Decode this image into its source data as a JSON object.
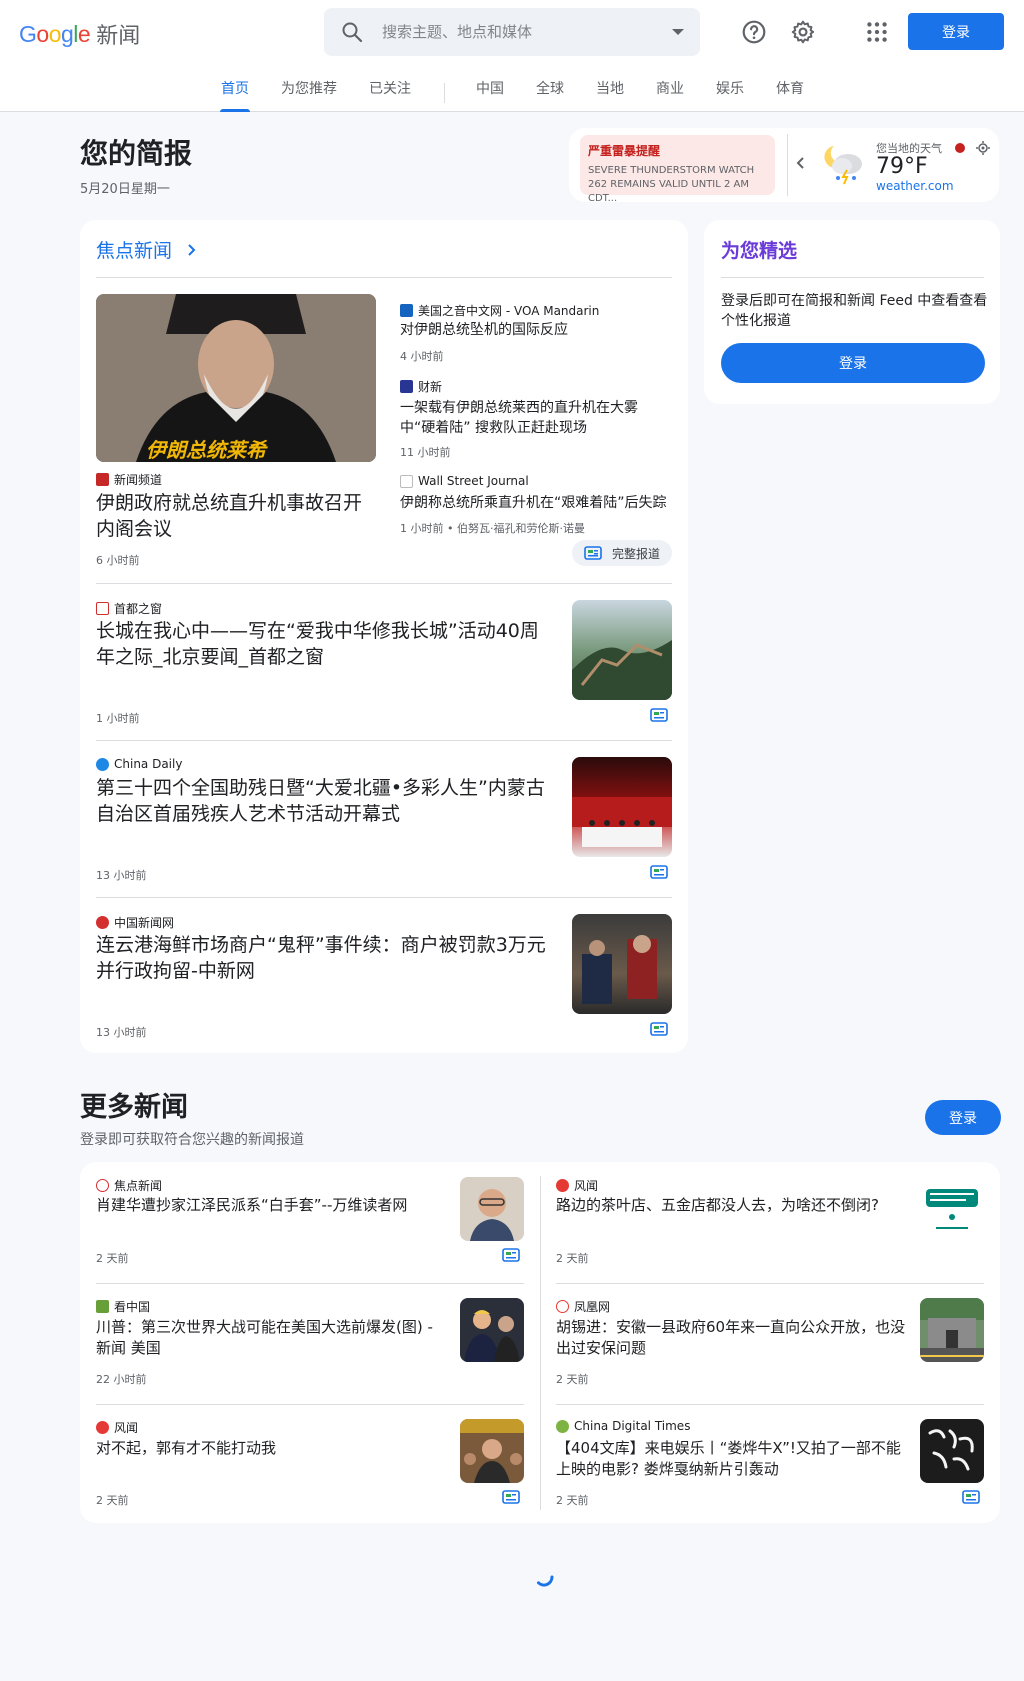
{
  "header": {
    "logo_text": "Google",
    "logo_suffix": "新闻",
    "search_placeholder": "搜索主题、地点和媒体",
    "login_label": "登录",
    "icons": [
      "search-icon",
      "help-icon",
      "settings-icon",
      "apps-icon"
    ]
  },
  "tabs": [
    {
      "label": "首页",
      "active": true
    },
    {
      "label": "为您推荐"
    },
    {
      "label": "已关注"
    },
    {
      "label": "中国"
    },
    {
      "label": "全球"
    },
    {
      "label": "当地"
    },
    {
      "label": "商业"
    },
    {
      "label": "娱乐"
    },
    {
      "label": "体育"
    }
  ],
  "briefing": {
    "title": "您的简报",
    "date": "5月20日星期一"
  },
  "weather": {
    "alert_title": "严重雷暴提醒",
    "alert_body": "SEVERE THUNDERSTORM WATCH 262 REMAINS VALID UNTIL 2 AM CDT...",
    "label": "您当地的天气",
    "temperature": "79°F",
    "source": "weather.com",
    "icon": "night-thunderstorm-icon"
  },
  "top_stories": {
    "title": "焦点新闻",
    "lead": {
      "source": "新闻频道",
      "headline": "伊朗政府就总统直升机事故召开内阁会议",
      "time": "6 小时前",
      "image_caption": "伊朗总统莱希"
    },
    "side": [
      {
        "source": "美国之音中文网 - VOA Mandarin",
        "headline": "对伊朗总统坠机的国际反应",
        "time": "4 小时前"
      },
      {
        "source": "财新",
        "headline": "一架载有伊朗总统莱西的直升机在大雾中“硬着陆” 搜救队正赶赴现场",
        "time": "11 小时前"
      },
      {
        "source": "Wall Street Journal",
        "headline": "伊朗称总统所乘直升机在“艰难着陆”后失踪",
        "time": "1 小时前 • 伯努瓦·福孔和劳伦斯·诺曼"
      }
    ],
    "full_coverage": "完整报道",
    "stories": [
      {
        "source": "首都之窗",
        "headline": "长城在我心中——写在“爱我中华修我长城”活动40周年之际_北京要闻_首都之窗",
        "time": "1 小时前"
      },
      {
        "source": "China Daily",
        "headline": "第三十四个全国助残日暨“大爱北疆•多彩人生”内蒙古自治区首届残疾人艺术节活动开幕式",
        "time": "13 小时前"
      },
      {
        "source": "中国新闻网",
        "headline": "连云港海鲜市场商户“鬼秤”事件续：商户被罚款3万元并行政拘留-中新网",
        "time": "13 小时前"
      }
    ]
  },
  "picks": {
    "title": "为您精选",
    "text": "登录后即可在简报和新闻 Feed 中查看查看个性化报道",
    "button": "登录"
  },
  "more_news": {
    "title": "更多新闻",
    "subtitle": "登录即可获取符合您兴趣的新闻报道",
    "button": "登录",
    "left": [
      {
        "source": "焦点新闻",
        "headline": "肖建华遭抄家江泽民派系“白手套”--万维读者网",
        "time": "2 天前"
      },
      {
        "source": "看中国",
        "headline": "川普：第三次世界大战可能在美国大选前爆发(图) - 新闻 美国",
        "time": "22 小时前"
      },
      {
        "source": "风闻",
        "headline": "对不起，郭有才不能打动我",
        "time": "2 天前"
      }
    ],
    "right": [
      {
        "source": "风闻",
        "headline": "路边的茶叶店、五金店都没人去，为啥还不倒闭?",
        "time": "2 天前"
      },
      {
        "source": "凤凰网",
        "headline": "胡锡进：安徽一县政府60年来一直向公众开放，也没出过安保问题",
        "time": "2 天前"
      },
      {
        "source": "China Digital Times",
        "headline": "【404文库】来电娱乐丨“娄烨牛X”!又拍了一部不能上映的电影? 娄烨戛纳新片引轰动",
        "time": "2 天前"
      }
    ]
  },
  "colors": {
    "accent": "#1a73e8",
    "alert": "#c5221f",
    "picks": "#6a3bd9"
  }
}
